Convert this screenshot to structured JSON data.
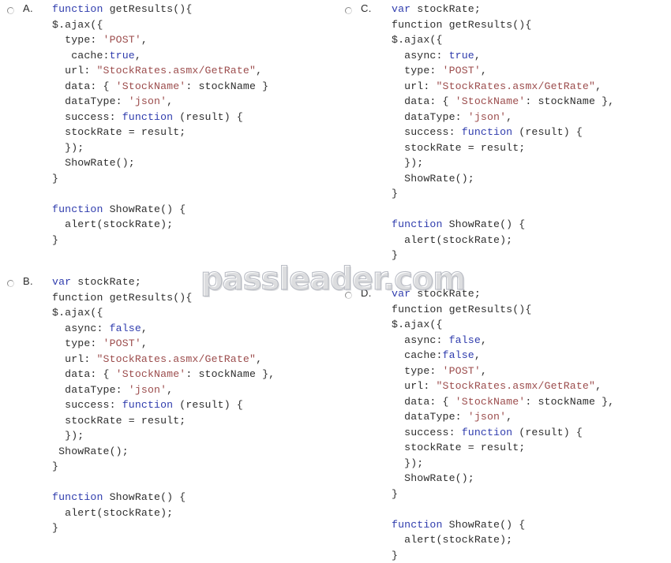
{
  "page": {
    "background_color": "#ffffff",
    "watermark": "passleader.com",
    "watermark_color": "#b9bcc4"
  },
  "syntax_colors": {
    "text": "#2e2e2e",
    "keyword": "#2f3cad",
    "boolean": "#2f3cad",
    "string": "#9c4d4d"
  },
  "options": [
    {
      "id": "a",
      "letter": "A.",
      "radio_checked": false,
      "code_lines": [
        [
          {
            "t": "function ",
            "c": "kw"
          },
          {
            "t": "getResults(){"
          }
        ],
        [
          {
            "t": "$.ajax({"
          }
        ],
        [
          {
            "t": "  type: "
          },
          {
            "t": "'POST'",
            "c": "str"
          },
          {
            "t": ","
          }
        ],
        [
          {
            "t": "   cache:"
          },
          {
            "t": "true",
            "c": "bool"
          },
          {
            "t": ","
          }
        ],
        [
          {
            "t": "  url: "
          },
          {
            "t": "\"StockRates.asmx/GetRate\"",
            "c": "str"
          },
          {
            "t": ","
          }
        ],
        [
          {
            "t": "  data: { "
          },
          {
            "t": "'StockName'",
            "c": "str"
          },
          {
            "t": ": stockName }"
          }
        ],
        [
          {
            "t": "  dataType: "
          },
          {
            "t": "'json'",
            "c": "str"
          },
          {
            "t": ","
          }
        ],
        [
          {
            "t": "  success: "
          },
          {
            "t": "function",
            "c": "kw"
          },
          {
            "t": " (result) {"
          }
        ],
        [
          {
            "t": "  stockRate = result;"
          }
        ],
        [
          {
            "t": "  });"
          }
        ],
        [
          {
            "t": "  ShowRate();"
          }
        ],
        [
          {
            "t": "}"
          }
        ],
        [
          {
            "t": ""
          }
        ],
        [
          {
            "t": "function",
            "c": "kw"
          },
          {
            "t": " ShowRate() {"
          }
        ],
        [
          {
            "t": "  alert(stockRate);"
          }
        ],
        [
          {
            "t": "}"
          }
        ]
      ]
    },
    {
      "id": "b",
      "letter": "B.",
      "radio_checked": false,
      "code_lines": [
        [
          {
            "t": "var",
            "c": "kw"
          },
          {
            "t": " stockRate;"
          }
        ],
        [
          {
            "t": "function getResults(){"
          }
        ],
        [
          {
            "t": "$.ajax({"
          }
        ],
        [
          {
            "t": "  async: "
          },
          {
            "t": "false",
            "c": "bool"
          },
          {
            "t": ","
          }
        ],
        [
          {
            "t": "  type: "
          },
          {
            "t": "'POST'",
            "c": "str"
          },
          {
            "t": ","
          }
        ],
        [
          {
            "t": "  url: "
          },
          {
            "t": "\"StockRates.asmx/GetRate\"",
            "c": "str"
          },
          {
            "t": ","
          }
        ],
        [
          {
            "t": "  data: { "
          },
          {
            "t": "'StockName'",
            "c": "str"
          },
          {
            "t": ": stockName },"
          }
        ],
        [
          {
            "t": "  dataType: "
          },
          {
            "t": "'json'",
            "c": "str"
          },
          {
            "t": ","
          }
        ],
        [
          {
            "t": "  success: "
          },
          {
            "t": "function",
            "c": "kw"
          },
          {
            "t": " (result) {"
          }
        ],
        [
          {
            "t": "  stockRate = result;"
          }
        ],
        [
          {
            "t": "  });"
          }
        ],
        [
          {
            "t": " ShowRate();"
          }
        ],
        [
          {
            "t": "}"
          }
        ],
        [
          {
            "t": ""
          }
        ],
        [
          {
            "t": "function",
            "c": "kw"
          },
          {
            "t": " ShowRate() {"
          }
        ],
        [
          {
            "t": "  alert(stockRate);"
          }
        ],
        [
          {
            "t": "}"
          }
        ]
      ]
    },
    {
      "id": "c",
      "letter": "C.",
      "radio_checked": false,
      "code_lines": [
        [
          {
            "t": "var",
            "c": "kw"
          },
          {
            "t": " stockRate;"
          }
        ],
        [
          {
            "t": "function getResults(){"
          }
        ],
        [
          {
            "t": "$.ajax({"
          }
        ],
        [
          {
            "t": "  async: "
          },
          {
            "t": "true",
            "c": "bool"
          },
          {
            "t": ","
          }
        ],
        [
          {
            "t": "  type: "
          },
          {
            "t": "'POST'",
            "c": "str"
          },
          {
            "t": ","
          }
        ],
        [
          {
            "t": "  url: "
          },
          {
            "t": "\"StockRates.asmx/GetRate\"",
            "c": "str"
          },
          {
            "t": ","
          }
        ],
        [
          {
            "t": "  data: { "
          },
          {
            "t": "'StockName'",
            "c": "str"
          },
          {
            "t": ": stockName },"
          }
        ],
        [
          {
            "t": "  dataType: "
          },
          {
            "t": "'json'",
            "c": "str"
          },
          {
            "t": ","
          }
        ],
        [
          {
            "t": "  success: "
          },
          {
            "t": "function",
            "c": "kw"
          },
          {
            "t": " (result) {"
          }
        ],
        [
          {
            "t": "  stockRate = result;"
          }
        ],
        [
          {
            "t": "  });"
          }
        ],
        [
          {
            "t": "  ShowRate();"
          }
        ],
        [
          {
            "t": "}"
          }
        ],
        [
          {
            "t": ""
          }
        ],
        [
          {
            "t": "function",
            "c": "kw"
          },
          {
            "t": " ShowRate() {"
          }
        ],
        [
          {
            "t": "  alert(stockRate);"
          }
        ],
        [
          {
            "t": "}"
          }
        ]
      ]
    },
    {
      "id": "d",
      "letter": "D.",
      "radio_checked": false,
      "code_lines": [
        [
          {
            "t": "var",
            "c": "kw"
          },
          {
            "t": " stockRate;"
          }
        ],
        [
          {
            "t": "function getResults(){"
          }
        ],
        [
          {
            "t": "$.ajax({"
          }
        ],
        [
          {
            "t": "  async: "
          },
          {
            "t": "false",
            "c": "bool"
          },
          {
            "t": ","
          }
        ],
        [
          {
            "t": "  cache:"
          },
          {
            "t": "false",
            "c": "bool"
          },
          {
            "t": ","
          }
        ],
        [
          {
            "t": "  type: "
          },
          {
            "t": "'POST'",
            "c": "str"
          },
          {
            "t": ","
          }
        ],
        [
          {
            "t": "  url: "
          },
          {
            "t": "\"StockRates.asmx/GetRate\"",
            "c": "str"
          },
          {
            "t": ","
          }
        ],
        [
          {
            "t": "  data: { "
          },
          {
            "t": "'StockName'",
            "c": "str"
          },
          {
            "t": ": stockName },"
          }
        ],
        [
          {
            "t": "  dataType: "
          },
          {
            "t": "'json'",
            "c": "str"
          },
          {
            "t": ","
          }
        ],
        [
          {
            "t": "  success: "
          },
          {
            "t": "function",
            "c": "kw"
          },
          {
            "t": " (result) {"
          }
        ],
        [
          {
            "t": "  stockRate = result;"
          }
        ],
        [
          {
            "t": "  });"
          }
        ],
        [
          {
            "t": "  ShowRate();"
          }
        ],
        [
          {
            "t": "}"
          }
        ],
        [
          {
            "t": ""
          }
        ],
        [
          {
            "t": "function",
            "c": "kw"
          },
          {
            "t": " ShowRate() {"
          }
        ],
        [
          {
            "t": "  alert(stockRate);"
          }
        ],
        [
          {
            "t": "}"
          }
        ]
      ]
    }
  ]
}
